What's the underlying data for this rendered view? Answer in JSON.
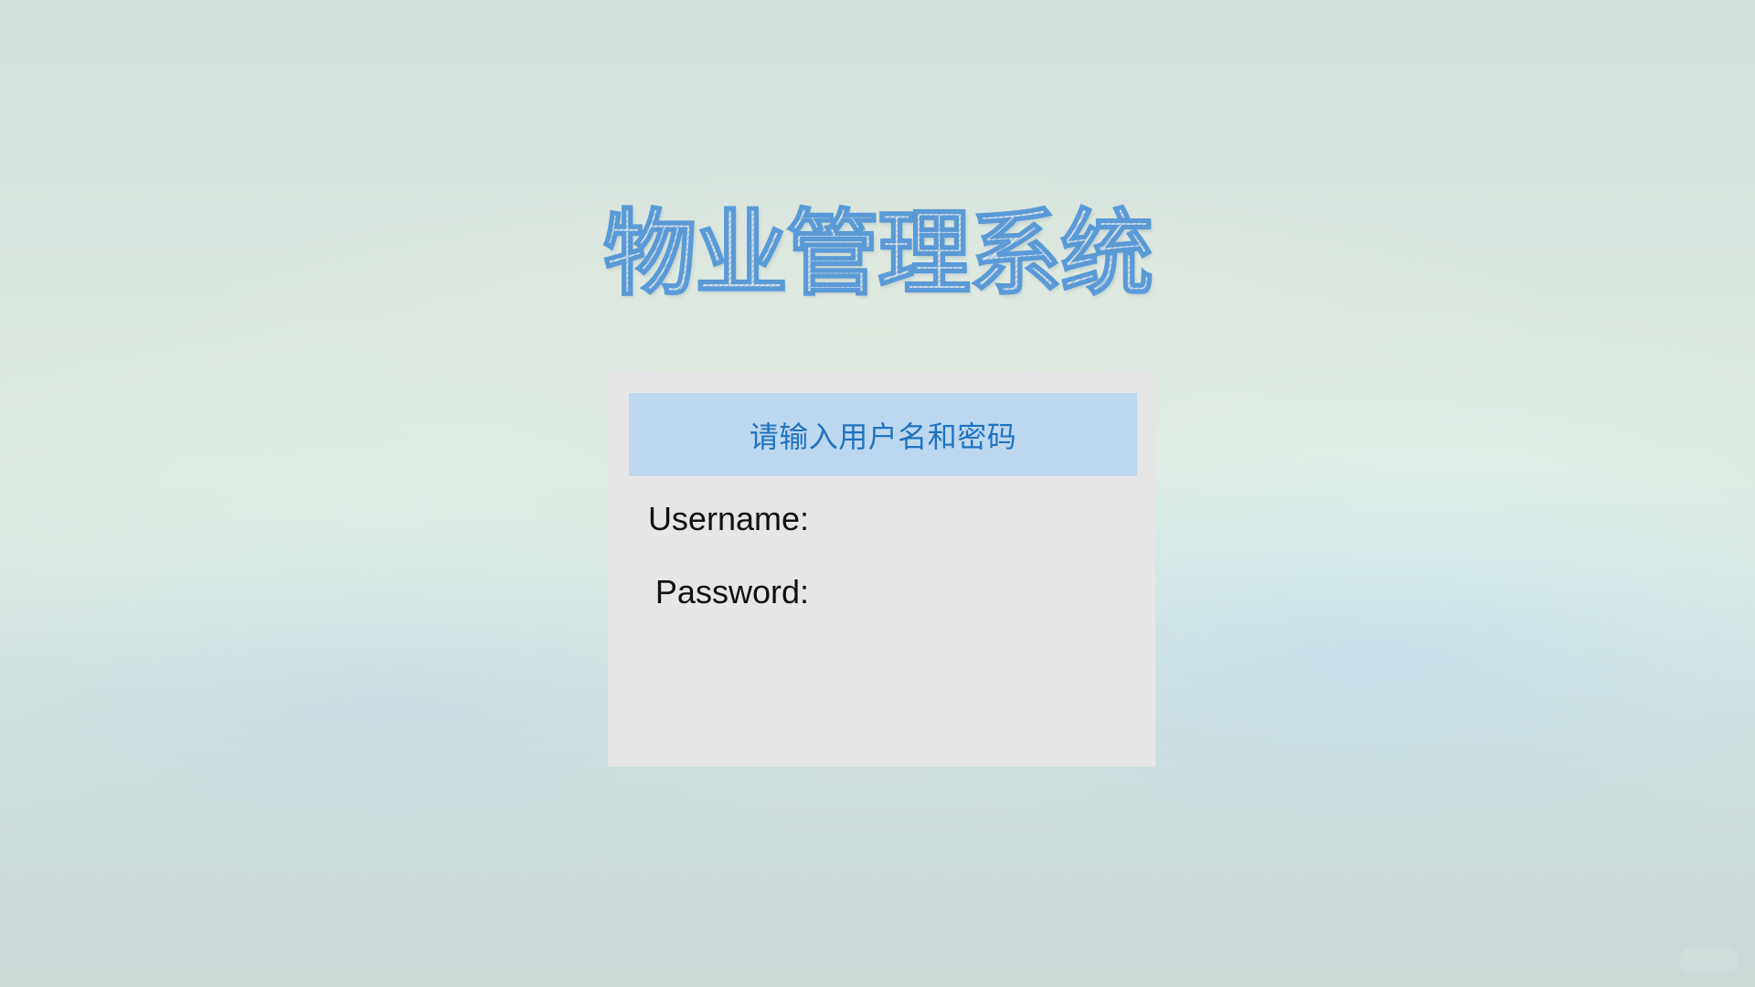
{
  "app": {
    "title": "物业管理系统"
  },
  "login": {
    "header": "请输入用户名和密码",
    "username_label": "Username:",
    "username_value": "",
    "password_label": "Password:",
    "password_value": ""
  },
  "colors": {
    "title_stroke": "#5a9ad6",
    "panel_background": "#e6e6e6",
    "header_background": "#bdd7ee",
    "header_text": "#1f73c0",
    "label_text": "#111111"
  }
}
